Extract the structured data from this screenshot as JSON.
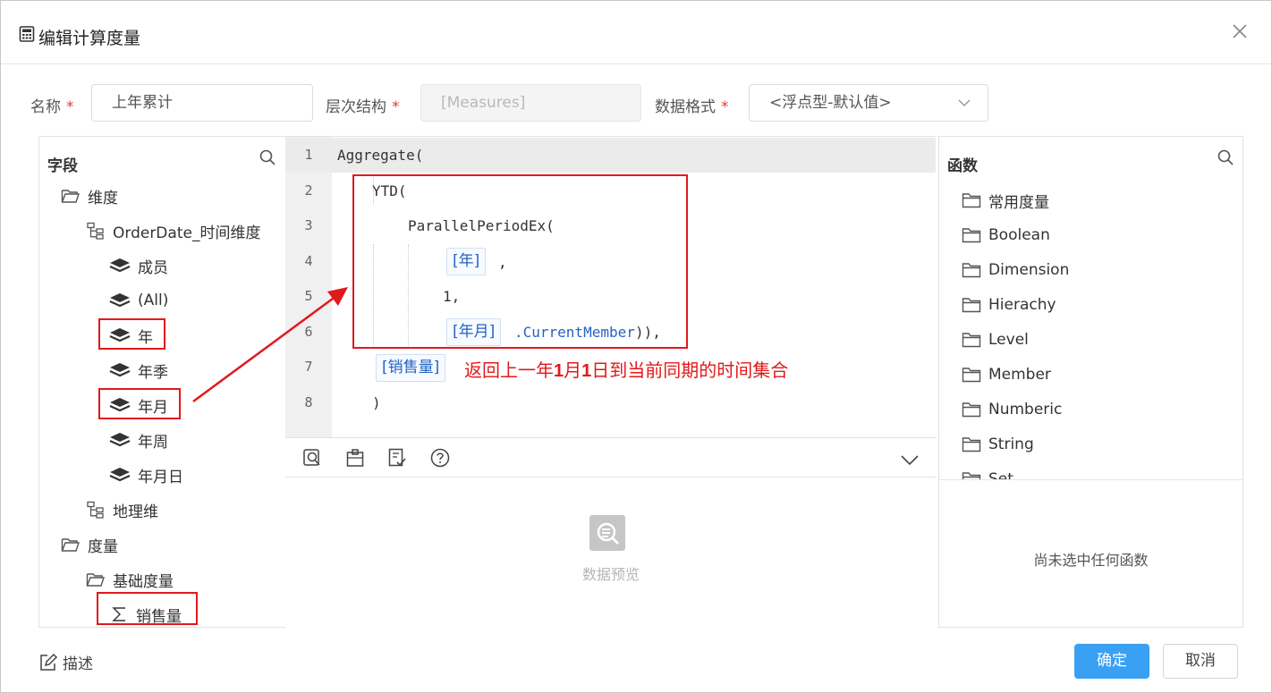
{
  "dialog": {
    "title": "编辑计算度量",
    "close_icon": "close-icon"
  },
  "form": {
    "name_label": "名称",
    "name_value": "上年累计",
    "hierarchy_label": "层次结构",
    "hierarchy_value": "[Measures]",
    "format_label": "数据格式",
    "format_value": "<浮点型-默认值>",
    "required_mark": "*"
  },
  "fields": {
    "header": "字段",
    "items": [
      {
        "label": "维度",
        "icon": "folder-open-icon"
      },
      {
        "label": "OrderDate_时间维度",
        "icon": "hierarchy-icon"
      },
      {
        "label": "成员",
        "icon": "layers-icon"
      },
      {
        "label": "(All)",
        "icon": "layers-icon"
      },
      {
        "label": "年",
        "icon": "layers-icon"
      },
      {
        "label": "年季",
        "icon": "layers-icon"
      },
      {
        "label": "年月",
        "icon": "layers-icon"
      },
      {
        "label": "年周",
        "icon": "layers-icon"
      },
      {
        "label": "年月日",
        "icon": "layers-icon"
      },
      {
        "label": "地理维",
        "icon": "hierarchy-icon"
      },
      {
        "label": "度量",
        "icon": "folder-open-icon"
      },
      {
        "label": "基础度量",
        "icon": "folder-open-icon"
      },
      {
        "label": "销售量",
        "icon": "sigma-icon"
      }
    ]
  },
  "editor": {
    "line_numbers": [
      "1",
      "2",
      "3",
      "4",
      "5",
      "6",
      "7",
      "8"
    ],
    "lines": {
      "l1": "Aggregate(",
      "l2": "YTD(",
      "l3": "ParallelPeriodEx(",
      "l4_tag": "[年]",
      "l4_rest": ",",
      "l5": "1,",
      "l6_tag": "[年月]",
      "l6_member": ".CurrentMember",
      "l6_rest": ")),",
      "l7_tag": "[销售量]",
      "l8": ")"
    }
  },
  "annotation": {
    "part1": "返回上一年",
    "part2": "1",
    "part3": "月",
    "part4": "1",
    "part5": "日到当前同期的时间集合"
  },
  "toolbar": {
    "tools": [
      "format-code-icon",
      "clipboard-icon",
      "validate-icon",
      "help-icon"
    ],
    "collapse_icon": "chevron-down-icon"
  },
  "preview": {
    "label": "数据预览"
  },
  "functions": {
    "header": "函数",
    "items": [
      "常用度量",
      "Boolean",
      "Dimension",
      "Hierachy",
      "Level",
      "Member",
      "Numberic",
      "String",
      "Set"
    ],
    "empty_text": "尚未选中任何函数"
  },
  "footer": {
    "describe_label": "描述",
    "confirm_label": "确定",
    "cancel_label": "取消"
  },
  "colors": {
    "primary": "#3aa0f3",
    "annotation_red": "#e2191b",
    "tag_blue": "#2463c4"
  }
}
